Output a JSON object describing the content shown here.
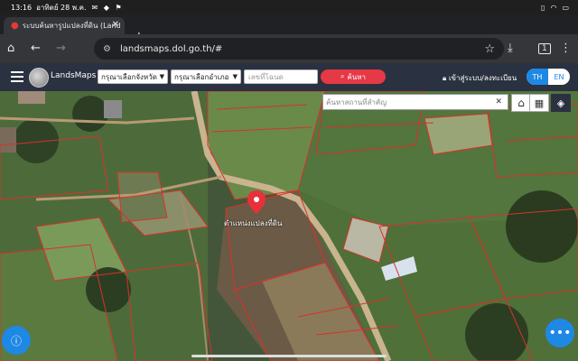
{
  "status_bar": {
    "time": "13:16",
    "date": "อาทิตย์ 28 พ.ค.",
    "icons": "✉ ◆ ⚑"
  },
  "browser": {
    "tab_title": "ระบบค้นหารูปแปลงที่ดิน (Lands",
    "url": "landsmaps.dol.go.th/#",
    "tabs_count": "1",
    "new_tab_label": "+"
  },
  "app": {
    "brand": "LandsMaps",
    "province_select": "กรุณาเลือกจังหวัด",
    "district_select": "กรุณาเลือกอำเภอ",
    "parcel_no_placeholder": "เลขที่โฉนด",
    "search_button": "ค้นหา",
    "login_link": "เข้าสู่ระบบ/ลงทะเบียน",
    "lang_th": "TH",
    "lang_en": "EN"
  },
  "map": {
    "place_search_placeholder": "ค้นหาสถานที่สำคัญ",
    "parcel_marker_label": "ตำแหน่งแปลงที่ดิน",
    "boundary_color": "#d9312b",
    "marker_color": "#e8303a"
  },
  "colors": {
    "nav_bg": "#2a3140",
    "accent_blue": "#1e88e5",
    "search_red": "#e53945"
  }
}
